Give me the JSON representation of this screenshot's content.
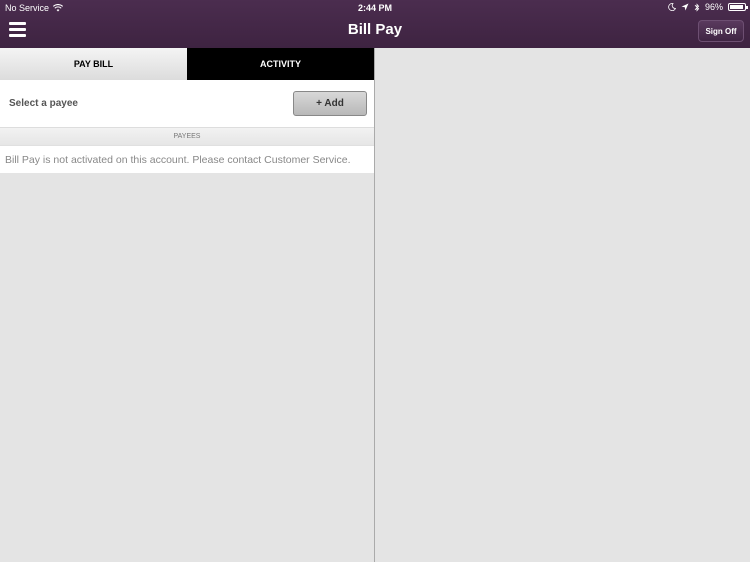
{
  "status_bar": {
    "carrier": "No Service",
    "time": "2:44 PM",
    "battery_percent": "96%",
    "battery_level": 0.96,
    "icons": [
      "wifi-icon",
      "moon-icon",
      "location-arrow-icon",
      "bluetooth-icon",
      "battery-icon"
    ]
  },
  "header": {
    "title": "Bill Pay",
    "menu_icon": "hamburger-menu-icon",
    "sign_off_label": "Sign Off"
  },
  "tabs": [
    {
      "label": "PAY BILL",
      "active": true
    },
    {
      "label": "ACTIVITY",
      "active": false
    }
  ],
  "payee_selector": {
    "label": "Select a payee",
    "add_button_label": "+ Add"
  },
  "payees_section": {
    "header": "PAYEES",
    "message": "Bill Pay is not activated on this account. Please contact Customer Service."
  },
  "colors": {
    "header_bg": "#42264a",
    "active_tab_bg": "#e8e8e8",
    "inactive_tab_bg": "#000000",
    "panel_bg": "#e4e4e4"
  }
}
